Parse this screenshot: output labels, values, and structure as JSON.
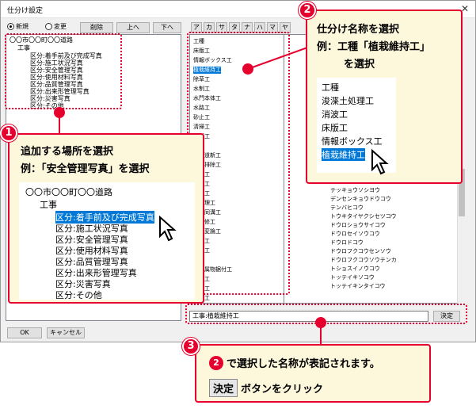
{
  "window": {
    "title": "仕分け設定",
    "close": "✕"
  },
  "toolbar": {
    "new_label": "新規",
    "change_label": "変更",
    "delete_label": "削除",
    "up_label": "上へ",
    "down_label": "下へ"
  },
  "kana_tabs": [
    "ア",
    "カ",
    "サ",
    "タ",
    "ナ",
    "ハ",
    "マ",
    "ヤ"
  ],
  "tree": {
    "root": "〇〇市〇〇町〇〇道路",
    "work": "工事",
    "items": [
      "区分:着手前及び完成写真",
      "区分:施工状況写真",
      "区分:安全管理写真",
      "区分:使用材料写真",
      "区分:品質管理写真",
      "区分:出来形管理写真",
      "区分:災害写真",
      "区分:その他"
    ]
  },
  "list_left": [
    "工種",
    "床版工",
    "情報ボックス工",
    "植栽維持工",
    "除草工",
    "水制工",
    "水門本体工",
    "水路工",
    "砂止工",
    "清掃工",
    "舗石工",
    "舗工",
    "下水道新工",
    "下水排除工",
    "水池工",
    "根覆工",
    "剥離工",
    "水処理工",
    "下共同溝工",
    "地補修工",
    "割付変論工",
    "植栽工",
    "舗装工",
    "土工",
    "水付属物据付工",
    "根本工",
    "橋梁工",
    "高欄工"
  ],
  "list_right": [
    "テッキョウソシヨウ",
    "デンセンキョウドウコウ",
    "テンバヒコウ",
    "トウキタイヤクシセツコウ",
    "ドウロショウサイコウ",
    "ドウロセイソウコウ",
    "ドウロドコウ",
    "ドウロフクコウセンソウ",
    "ドウロフクコウソウテンカ",
    "トショスイノウコウ",
    "トッテイキソコウ",
    "トッテイキンタイコウ"
  ],
  "selected_name": "工事:植栽維持工",
  "decide_label": "決定",
  "footer": {
    "ok_label": "OK",
    "cancel_label": "キャンセル"
  },
  "callout1": {
    "number": "1",
    "line1": "追加する場所を選択",
    "line2": "例：「安全管理写真」を選択",
    "root": "〇〇市〇〇町〇〇道路",
    "work": "工事",
    "items": [
      "区分:着手前及び完成写真",
      "区分:施工状況写真",
      "区分:安全管理写真",
      "区分:使用材料写真",
      "区分:品質管理写真",
      "区分:出来形管理写真",
      "区分:災害写真",
      "区分:その他"
    ]
  },
  "callout2": {
    "number": "2",
    "line1": "仕分け名称を選択",
    "line2": "例：工種「植栽維持工」",
    "line3": "を選択",
    "items": [
      "工種",
      "浚渫土処理工",
      "消波工",
      "床版工",
      "情報ボックス工",
      "植栽維持工"
    ]
  },
  "callout3": {
    "number": "3",
    "circle": "2",
    "line1": "で選択した名称が表記されます。",
    "button": "決定",
    "line2": "ボタンをクリック"
  },
  "colors": {
    "accent": "#e6002d",
    "callout_bg": "#fdf7dc",
    "select": "#0078d7"
  }
}
